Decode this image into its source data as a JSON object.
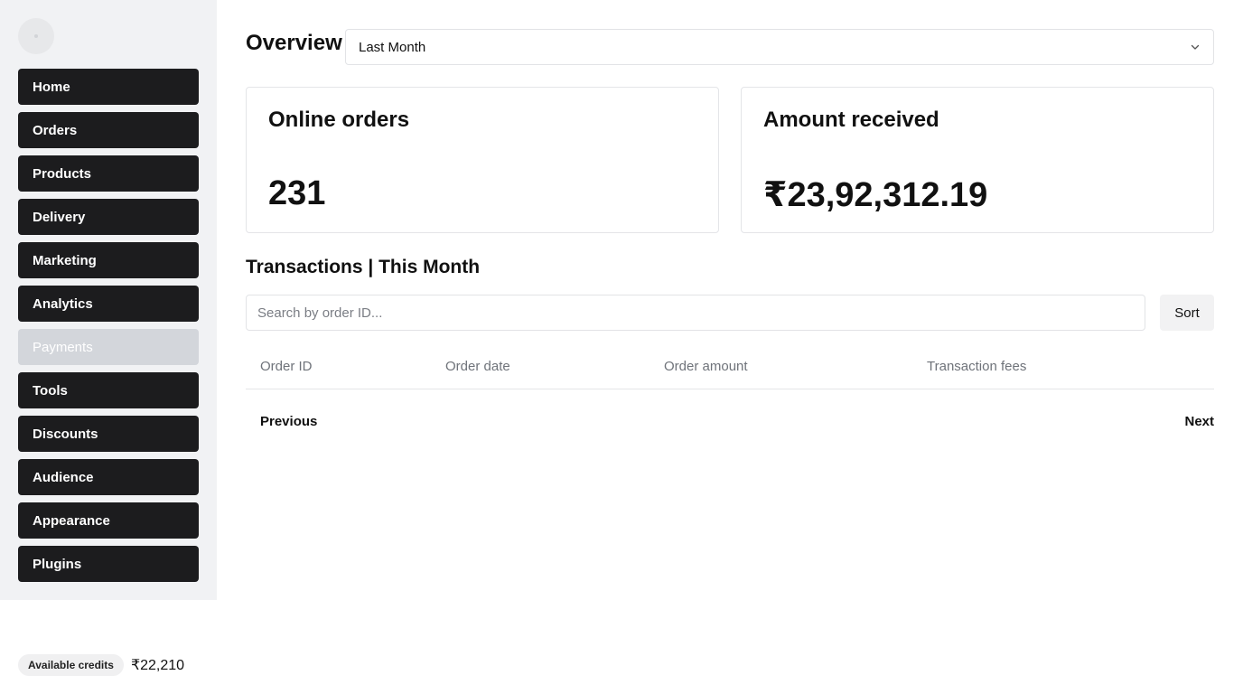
{
  "sidebar": {
    "items": [
      {
        "label": "Home"
      },
      {
        "label": "Orders"
      },
      {
        "label": "Products"
      },
      {
        "label": "Delivery"
      },
      {
        "label": "Marketing"
      },
      {
        "label": "Analytics"
      },
      {
        "label": "Payments",
        "active": true
      },
      {
        "label": "Tools"
      },
      {
        "label": "Discounts"
      },
      {
        "label": "Audience"
      },
      {
        "label": "Appearance"
      },
      {
        "label": "Plugins"
      }
    ],
    "credits": {
      "label": "Available credits",
      "value": "₹22,210"
    }
  },
  "header": {
    "title": "Overview",
    "period_select": {
      "value": "Last Month",
      "icon": "chevron-down-icon"
    }
  },
  "cards": [
    {
      "title": "Online orders",
      "value": "231"
    },
    {
      "title": "Amount received",
      "value": "₹23,92,312.19"
    }
  ],
  "transactions": {
    "title": "Transactions | This Month",
    "search_placeholder": "Search by order ID...",
    "sort_label": "Sort",
    "columns": [
      "Order ID",
      "Order date",
      "Order amount",
      "Transaction fees"
    ],
    "rows": [],
    "pagination": {
      "previous": "Previous",
      "next": "Next"
    }
  },
  "colors": {
    "nav_bg": "#1c1c1e",
    "nav_active_bg": "#d3d6db",
    "sidebar_bg": "#f1f2f4"
  }
}
